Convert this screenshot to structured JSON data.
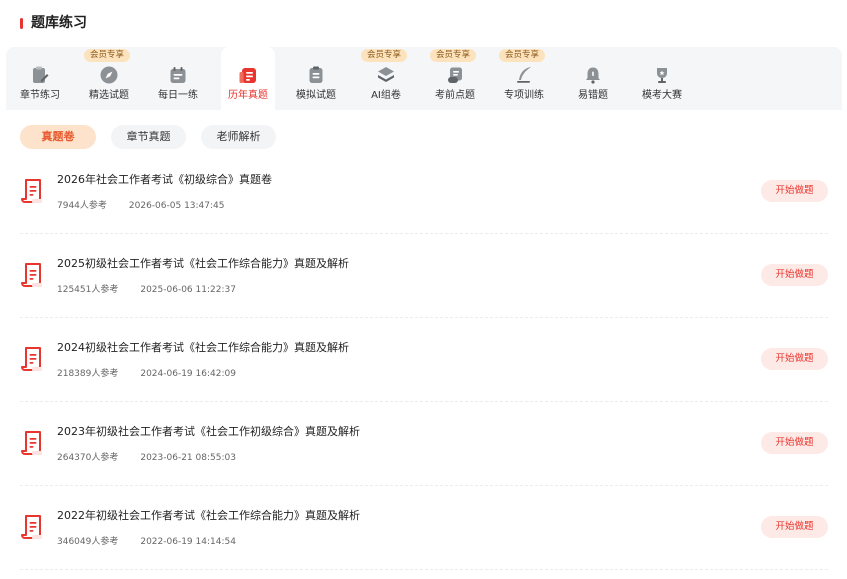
{
  "page": {
    "title": "题库练习"
  },
  "tabs": [
    {
      "label": "章节练习",
      "vip": "",
      "icon": "clipboard-pencil-icon",
      "active": false
    },
    {
      "label": "精选试题",
      "vip": "会员专享",
      "icon": "compass-icon",
      "active": false
    },
    {
      "label": "每日一练",
      "vip": "",
      "icon": "calendar-icon",
      "active": false
    },
    {
      "label": "历年真题",
      "vip": "",
      "icon": "exam-paper-icon",
      "active": true
    },
    {
      "label": "模拟试题",
      "vip": "",
      "icon": "checklist-icon",
      "active": false
    },
    {
      "label": "AI组卷",
      "vip": "会员专享",
      "icon": "layers-icon",
      "active": false
    },
    {
      "label": "考前点题",
      "vip": "会员专享",
      "icon": "scroll-icon",
      "active": false
    },
    {
      "label": "专项训练",
      "vip": "会员专享",
      "icon": "quill-icon",
      "active": false
    },
    {
      "label": "易错题",
      "vip": "",
      "icon": "alert-bell-icon",
      "active": false
    },
    {
      "label": "模考大赛",
      "vip": "",
      "icon": "trophy-icon",
      "active": false
    }
  ],
  "filters": [
    {
      "label": "真题卷",
      "active": true
    },
    {
      "label": "章节真题",
      "active": false
    },
    {
      "label": "老师解析",
      "active": false
    }
  ],
  "papers": [
    {
      "title": "2026年社会工作者考试《初级综合》真题卷",
      "participants": "7944人参考",
      "date": "2026-06-05 13:47:45",
      "action": "开始做题"
    },
    {
      "title": "2025初级社会工作者考试《社会工作综合能力》真题及解析",
      "participants": "125451人参考",
      "date": "2025-06-06 11:22:37",
      "action": "开始做题"
    },
    {
      "title": "2024初级社会工作者考试《社会工作综合能力》真题及解析",
      "participants": "218389人参考",
      "date": "2024-06-19 16:42:09",
      "action": "开始做题"
    },
    {
      "title": "2023年初级社会工作者考试《社会工作初级综合》真题及解析",
      "participants": "264370人参考",
      "date": "2023-06-21 08:55:03",
      "action": "开始做题"
    },
    {
      "title": "2022年初级社会工作者考试《社会工作综合能力》真题及解析",
      "participants": "346049人参考",
      "date": "2022-06-19 14:14:54",
      "action": "开始做题"
    }
  ],
  "colors": {
    "accent": "#e8352e",
    "vip_badge": "#fde3bd",
    "active_filter": "#fde3cc",
    "icon_gray": "#8c9196"
  }
}
